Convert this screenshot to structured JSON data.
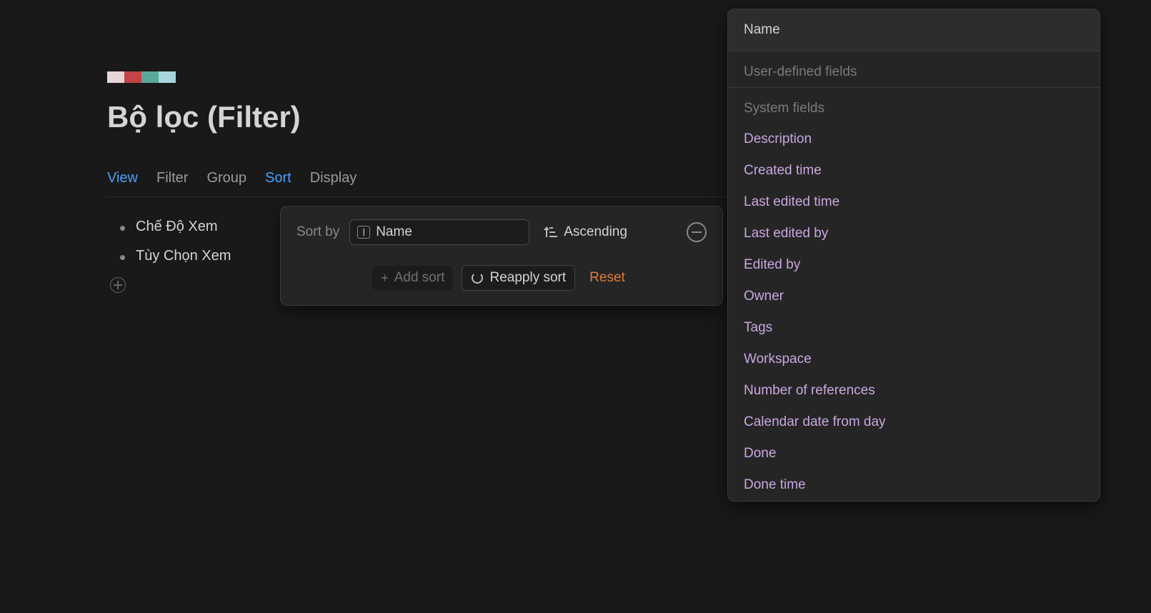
{
  "page": {
    "title": "Bộ lọc (Filter)"
  },
  "tabs": {
    "view": "View",
    "filter": "Filter",
    "group": "Group",
    "sort": "Sort",
    "display": "Display"
  },
  "list": {
    "item1": "Chế Độ Xem",
    "item2": "Tùy Chọn Xem"
  },
  "sort_popover": {
    "label": "Sort by",
    "field": "Name",
    "direction": "Ascending",
    "add": "Add sort",
    "reapply": "Reapply sort",
    "reset": "Reset"
  },
  "field_dropdown": {
    "selected": "Name",
    "user_fields_header": "User-defined fields",
    "system_fields_header": "System fields",
    "system_fields": {
      "description": "Description",
      "created_time": "Created time",
      "last_edited_time": "Last edited time",
      "last_edited_by": "Last edited by",
      "edited_by": "Edited by",
      "owner": "Owner",
      "tags": "Tags",
      "workspace": "Workspace",
      "num_refs": "Number of references",
      "calendar_date": "Calendar date from day",
      "done": "Done",
      "done_time": "Done time"
    }
  }
}
